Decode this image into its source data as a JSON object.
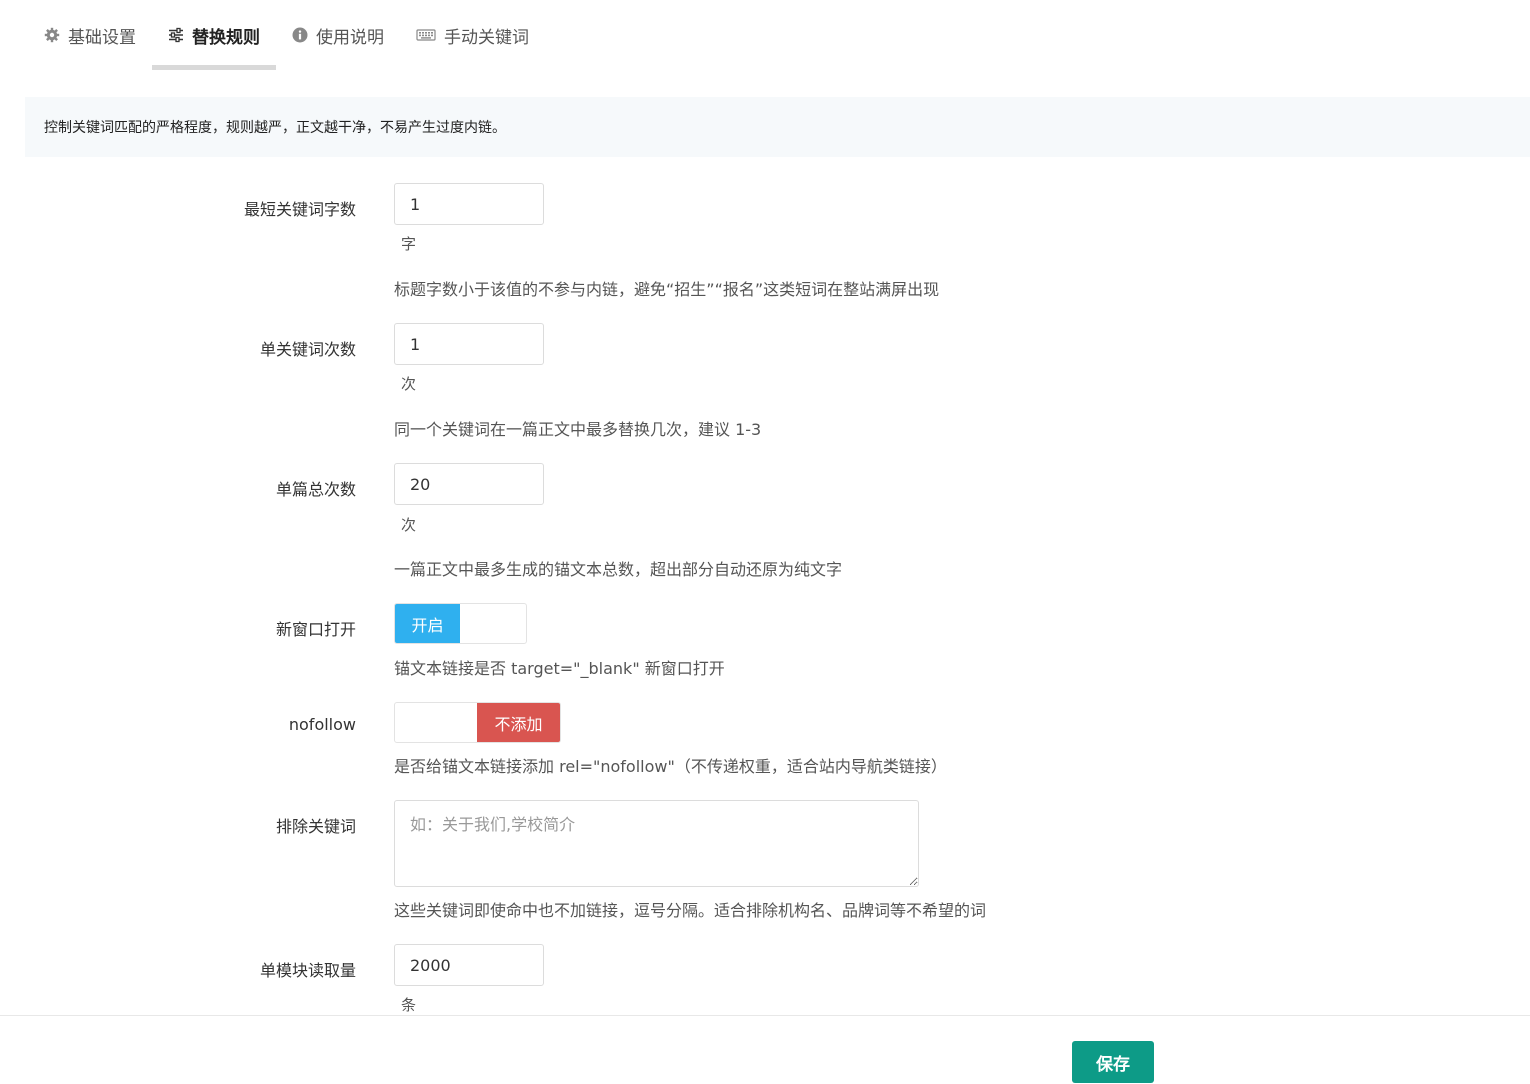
{
  "tabs": [
    {
      "label": "基础设置",
      "icon": "gear-icon",
      "active": false
    },
    {
      "label": "替换规则",
      "icon": "sliders-icon",
      "active": true
    },
    {
      "label": "使用说明",
      "icon": "info-icon",
      "active": false
    },
    {
      "label": "手动关键词",
      "icon": "keyboard-icon",
      "active": false
    }
  ],
  "notice": "控制关键词匹配的严格程度，规则越严，正文越干净，不易产生过度内链。",
  "form": {
    "min_len": {
      "label": "最短关键词字数",
      "value": "1",
      "unit": "字",
      "help": "标题字数小于该值的不参与内链，避免“招生”“报名”这类短词在整站满屏出现"
    },
    "per_keyword": {
      "label": "单关键词次数",
      "value": "1",
      "unit": "次",
      "help": "同一个关键词在一篇正文中最多替换几次，建议 1-3"
    },
    "per_article": {
      "label": "单篇总次数",
      "value": "20",
      "unit": "次",
      "help": "一篇正文中最多生成的锚文本总数，超出部分自动还原为纯文字"
    },
    "new_window": {
      "label": "新窗口打开",
      "state_label": "开启",
      "state": "on",
      "help": "锚文本链接是否 target=\"_blank\" 新窗口打开"
    },
    "nofollow": {
      "label": "nofollow",
      "state_label": "不添加",
      "state": "off",
      "help": "是否给锚文本链接添加 rel=\"nofollow\"（不传递权重，适合站内导航类链接）"
    },
    "exclude": {
      "label": "排除关键词",
      "placeholder": "如：关于我们,学校简介",
      "value": "",
      "help": "这些关键词即使命中也不加链接，逗号分隔。适合排除机构名、品牌词等不希望的词"
    },
    "read_limit": {
      "label": "单模块读取量",
      "value": "2000",
      "unit": "条"
    }
  },
  "footer": {
    "save_label": "保存"
  },
  "colors": {
    "toggle_on": "#2fb0ef",
    "toggle_off": "#d95550",
    "save_button": "#0d9b87",
    "notice_bg": "#f6f9fb"
  }
}
